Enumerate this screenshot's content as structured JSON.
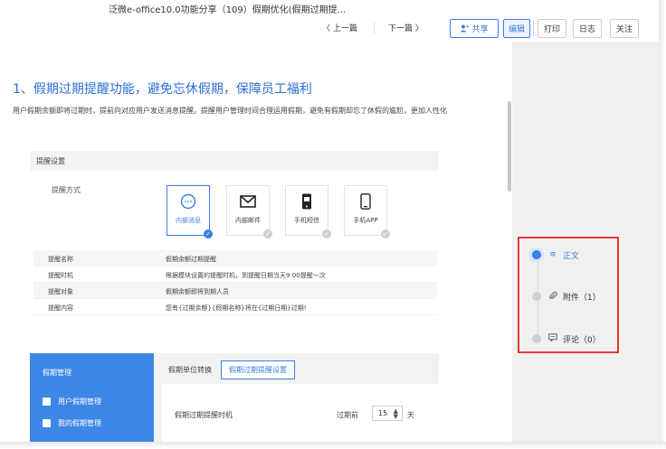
{
  "header": {
    "doc_title": "泛微e-office10.0功能分享（109）假期优化(假期过期提...",
    "prev_label": "〈 上一篇",
    "next_label": "下一篇 〉",
    "share_label": "共享",
    "edit_label": "编辑",
    "print_label": "打印",
    "log_label": "日志",
    "follow_label": "关注"
  },
  "article": {
    "heading": "1、假期过期提醒功能，避免忘休假期，保障员工福利",
    "paragraph": "用户假期余额即将过期时，提前向对应用户发送消息提醒。提醒用户管理时间合理运用假期，避免有假期却忘了休假的尴尬，更加人性化"
  },
  "settings": {
    "header": "提醒设置",
    "remind_method_label": "提醒方式",
    "options": [
      {
        "label": "内部消息",
        "icon": "chat-bubble-icon",
        "selected": true
      },
      {
        "label": "内部邮件",
        "icon": "mail-icon",
        "selected": false
      },
      {
        "label": "手机短信",
        "icon": "phone-sms-icon",
        "selected": false
      },
      {
        "label": "手机APP",
        "icon": "mobile-app-icon",
        "selected": false
      }
    ],
    "rows": [
      {
        "key": "提醒名称",
        "value": "假期余额过期提醒"
      },
      {
        "key": "提醒时机",
        "value": "根据模块设置的提醒时机，到提醒日期当天9:00提醒一次"
      },
      {
        "key": "提醒对象",
        "value": "假期余额即将到期人员"
      },
      {
        "key": "提醒内容",
        "value": "您有{过期余额}{假期名称}将在{过期日期}过期!"
      }
    ]
  },
  "app_panel": {
    "side_title": "假期管理",
    "side_items": [
      "用户假期管理",
      "我的假期管理"
    ],
    "tab_plain": "假期单位转换",
    "tab_active": "假期过期提醒设置",
    "field_label": "假期过期提醒时机",
    "before_label": "过期前",
    "days_value": "15",
    "unit_label": "天"
  },
  "toc": {
    "items": [
      {
        "label": "正文",
        "icon": "text-lines-icon",
        "active": true
      },
      {
        "label": "附件（1）",
        "icon": "paperclip-icon",
        "active": false
      },
      {
        "label": "评论（0）",
        "icon": "comment-icon",
        "active": false
      }
    ]
  },
  "colors": {
    "accent": "#3a7ee6",
    "heading_blue": "#2d6fd6",
    "highlight_red": "#e53935",
    "panel_gray": "#f0f0f0"
  }
}
